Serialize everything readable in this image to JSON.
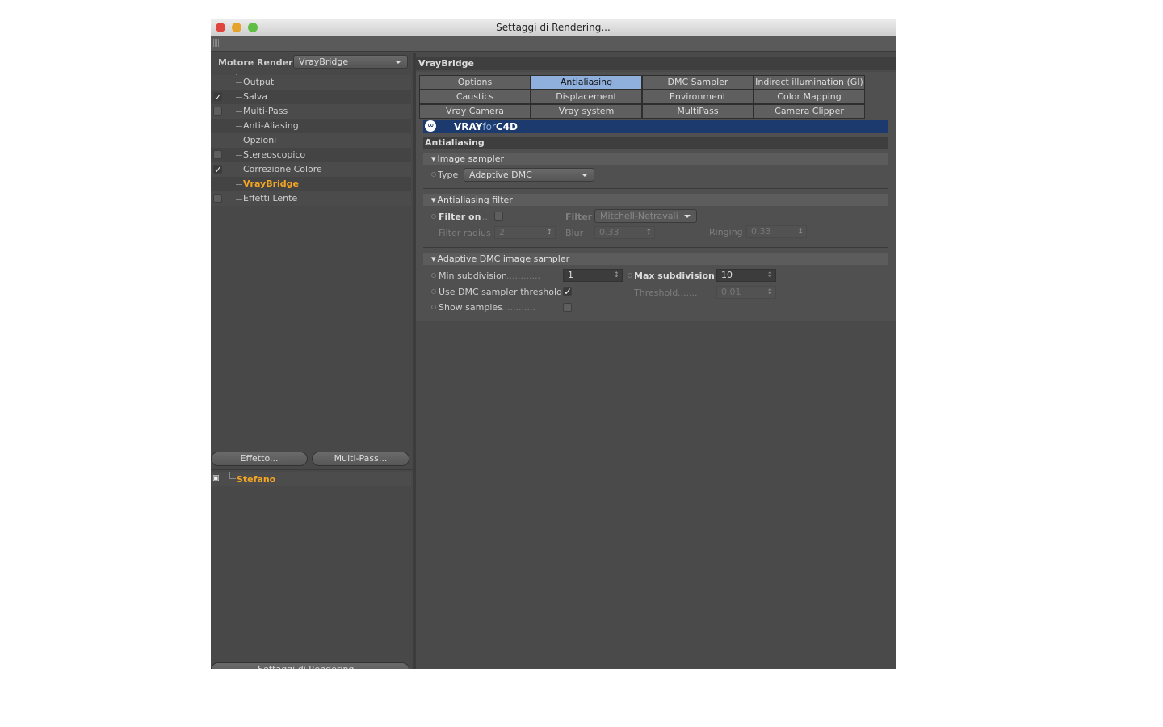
{
  "window": {
    "title": "Settaggi di Rendering..."
  },
  "left": {
    "engine_label": "Motore Render",
    "engine_value": "VrayBridge",
    "items": [
      {
        "label": "Output",
        "check": "none"
      },
      {
        "label": "Salva",
        "check": "checked"
      },
      {
        "label": "Multi-Pass",
        "check": "unchecked"
      },
      {
        "label": "Anti-Aliasing",
        "check": "none"
      },
      {
        "label": "Opzioni",
        "check": "none"
      },
      {
        "label": "Stereoscopico",
        "check": "unchecked"
      },
      {
        "label": "Correzione Colore",
        "check": "checked"
      },
      {
        "label": "VrayBridge",
        "check": "none",
        "active": true
      },
      {
        "label": "Effetti Lente",
        "check": "unchecked"
      }
    ],
    "effect_button": "Effetto...",
    "multipass_button": "Multi-Pass...",
    "preset": "Stefano",
    "bottom_button": "Settaggi di Rendering..."
  },
  "right": {
    "header": "VrayBridge",
    "tabs": [
      "Options",
      "Antialiasing",
      "DMC Sampler",
      "Indirect illumination (GI)",
      "Caustics",
      "Displacement",
      "Environment",
      "Color Mapping",
      "Vray Camera",
      "Vray system",
      "MultiPass",
      "Camera Clipper"
    ],
    "active_tab": "Antialiasing",
    "logo": {
      "a": "VRAY",
      "b": "for",
      "c": "C4D"
    },
    "section_title": "Antialiasing",
    "image_sampler": {
      "title": "Image sampler",
      "type_label": "Type",
      "type_value": "Adaptive DMC"
    },
    "aa_filter": {
      "title": "Antialiasing filter",
      "filter_on_label": "Filter on",
      "filter_on_dots": "..",
      "filter_label": "Filter",
      "filter_value": "Mitchell-Netravali",
      "radius_label": "Filter radius",
      "radius_value": "2",
      "blur_label": "Blur",
      "blur_value": "0.33",
      "ringing_label": "Ringing",
      "ringing_value": "0.33"
    },
    "adaptive": {
      "title": "Adaptive DMC image sampler",
      "min_label": "Min subdivision",
      "min_dots": "............",
      "min_value": "1",
      "max_label": "Max subdivision",
      "max_value": "10",
      "use_thr_label": "Use DMC sampler threshold",
      "thr_label": "Threshold",
      "thr_dots": ".......",
      "thr_value": "0.01",
      "show_label": "Show samples",
      "show_dots": "............"
    }
  },
  "colors": {
    "accent": "#f5a623",
    "tab_active": "#8fb0dc",
    "logo_bar": "#1d3a6e"
  }
}
